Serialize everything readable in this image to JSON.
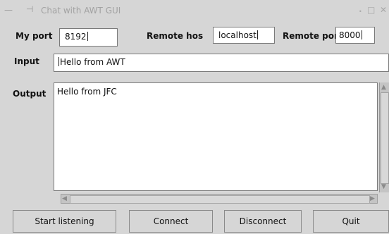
{
  "window": {
    "title": "Chat with AWT GUI"
  },
  "labels": {
    "my_port": "My port",
    "remote_host": "Remote hos",
    "remote_port": "Remote por",
    "input": "Input",
    "output": "Output"
  },
  "fields": {
    "my_port": "8192",
    "remote_host": "localhost",
    "remote_port": "8000",
    "input": "Hello from AWT"
  },
  "output_text": "Hello from JFC",
  "buttons": {
    "start": "Start listening",
    "connect": "Connect",
    "disconnect": "Disconnect",
    "quit": "Quit"
  }
}
